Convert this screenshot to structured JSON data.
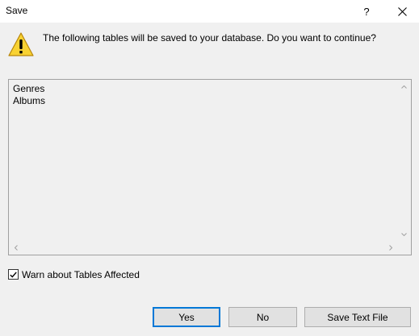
{
  "window": {
    "title": "Save",
    "help_label": "?"
  },
  "message": "The following tables will be saved to your database. Do you want to continue?",
  "tables": [
    "Genres",
    "Albums"
  ],
  "checkbox": {
    "label": "Warn about Tables Affected",
    "checked": true
  },
  "buttons": {
    "yes": "Yes",
    "no": "No",
    "save_text_file": "Save Text File"
  },
  "icons": {
    "warning": "warning-icon",
    "close": "close-icon"
  },
  "colors": {
    "accent": "#0078d7",
    "warning_fill": "#f8d233",
    "warning_stroke": "#b8860b"
  }
}
